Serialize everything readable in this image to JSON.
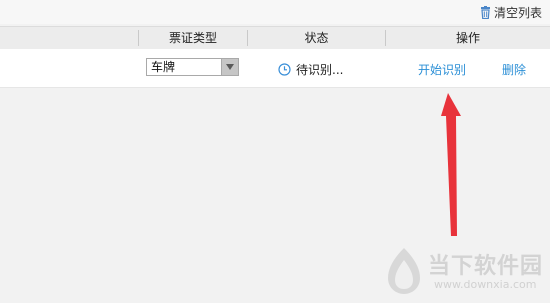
{
  "toolbar": {
    "clear_list_label": "清空列表"
  },
  "table": {
    "columns": [
      "票证类型",
      "状态",
      "操作"
    ],
    "rows": [
      {
        "ticket_type": "车牌",
        "status": "待识别...",
        "actions": {
          "start": "开始识别",
          "delete": "删除"
        }
      }
    ]
  },
  "icons": {
    "clear_list": "trash-icon",
    "status": "clock-icon",
    "dropdown": "chevron-down-icon"
  },
  "colors": {
    "link": "#2b8fd6",
    "annotation_arrow": "#e8333b",
    "status_icon": "#3a8fd8"
  },
  "watermark": {
    "name": "当下软件园",
    "url": "www.downxia.com"
  }
}
